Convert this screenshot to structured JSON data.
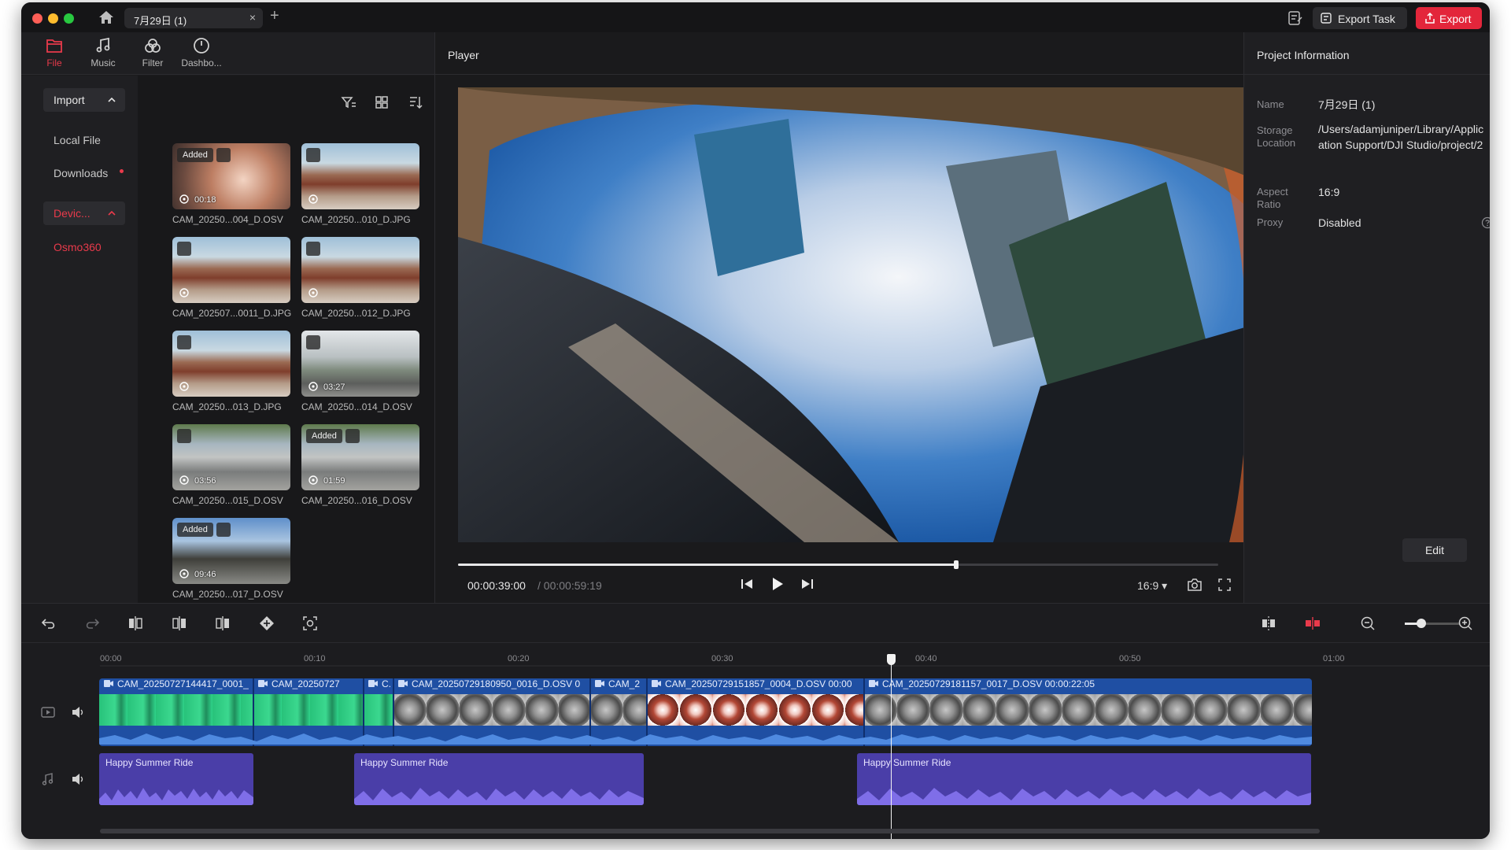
{
  "window": {
    "tab_title": "7月29日 (1)",
    "tab_close": "×",
    "tab_add": "+",
    "export_task_label": "Export Task",
    "export_label": "Export"
  },
  "media_tabs": [
    {
      "label": "File",
      "icon": "folder-icon",
      "active": true
    },
    {
      "label": "Music",
      "icon": "music-note-icon",
      "active": false
    },
    {
      "label": "Filter",
      "icon": "filter-circles-icon",
      "active": false
    },
    {
      "label": "Dashbo...",
      "icon": "gauge-icon",
      "active": false
    }
  ],
  "sidenav": {
    "import_label": "Import",
    "local_file": "Local File",
    "downloads": "Downloads",
    "device_label": "Devic...",
    "device_name": "Osmo360"
  },
  "media_items": [
    {
      "name": "CAM_20250...004_D.OSV",
      "added": "Added",
      "duration": "00:18",
      "scene": "car"
    },
    {
      "name": "CAM_20250...010_D.JPG",
      "added": "",
      "duration": "",
      "scene": "plaza"
    },
    {
      "name": "CAM_202507...0011_D.JPG",
      "added": "",
      "duration": "",
      "scene": "plaza"
    },
    {
      "name": "CAM_20250...012_D.JPG",
      "added": "",
      "duration": "",
      "scene": "plaza"
    },
    {
      "name": "CAM_20250...013_D.JPG",
      "added": "",
      "duration": "",
      "scene": "plaza"
    },
    {
      "name": "CAM_20250...014_D.OSV",
      "added": "",
      "duration": "03:27",
      "scene": "street"
    },
    {
      "name": "CAM_20250...015_D.OSV",
      "added": "",
      "duration": "03:56",
      "scene": "road"
    },
    {
      "name": "CAM_20250...016_D.OSV",
      "added": "Added",
      "duration": "01:59",
      "scene": "road"
    },
    {
      "name": "CAM_20250...017_D.OSV",
      "added": "Added",
      "duration": "09:46",
      "scene": "sky"
    }
  ],
  "player": {
    "title": "Player",
    "time_current": "00:00:39:00",
    "time_total": "/ 00:00:59:19",
    "aspect_ratio": "16:9",
    "progress_fraction": 0.655
  },
  "project_info": {
    "title": "Project Information",
    "fields": [
      {
        "key": "Name",
        "value": "7月29日 (1)"
      },
      {
        "key": "Storage Location",
        "value": "/Users/adamjuniper/Library/Application Support/DJI Studio/project/2"
      },
      {
        "key": "Aspect Ratio",
        "value": "16:9"
      },
      {
        "key": "Proxy",
        "value": "Disabled"
      }
    ],
    "edit_label": "Edit"
  },
  "timeline": {
    "ruler_ticks": [
      "00:00",
      "00:10",
      "00:20",
      "00:30",
      "00:40",
      "00:50",
      "01:00"
    ],
    "video_clips": [
      {
        "label": "CAM_20250727144417_0001_",
        "style": "green"
      },
      {
        "label": "CAM_20250727",
        "style": "green"
      },
      {
        "label": "C.",
        "style": "green"
      },
      {
        "label": "CAM_20250729180950_0016_D.OSV  0",
        "style": "grey"
      },
      {
        "label": "CAM_2",
        "style": "grey"
      },
      {
        "label": "CAM_20250729151857_0004_D.OSV  00:00",
        "style": "red"
      },
      {
        "label": "CAM_20250729181157_0017_D.OSV   00:00:22:05",
        "style": "grey"
      }
    ],
    "audio_clips": [
      {
        "label": "Happy Summer Ride"
      },
      {
        "label": "Happy Summer Ride"
      },
      {
        "label": "Happy Summer Ride"
      }
    ],
    "zoom_level_fraction": 0.3
  },
  "colors": {
    "accent": "#e93a4b",
    "video_track": "#1f4fa3",
    "audio_track": "#4a3ea8"
  }
}
